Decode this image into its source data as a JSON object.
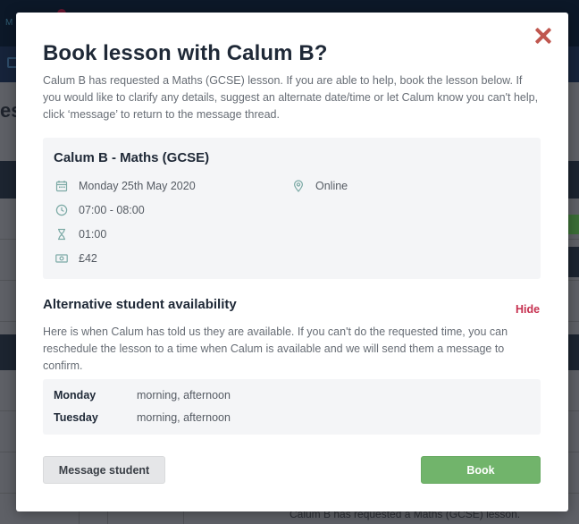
{
  "background": {
    "brand_fragment": "M",
    "title_fragment": "es",
    "footer_text": "Calum B has requested a Maths (GCSE) lesson."
  },
  "modal": {
    "title": "Book lesson with Calum B?",
    "intro": "Calum B has requested a Maths (GCSE) lesson. If you are able to help, book the lesson below. If you would like to clarify any details, suggest an alternate date/time or let Calum know you can't help, click ‘message’ to return to the message thread.",
    "close_icon": "close-icon",
    "lesson": {
      "title": "Calum B - Maths (GCSE)",
      "date": "Monday 25th May 2020",
      "location": "Online",
      "time": "07:00 - 08:00",
      "duration": "01:00",
      "price": "£42"
    },
    "alternative": {
      "title": "Alternative student availability",
      "hide_label": "Hide",
      "text": "Here is when Calum has told us they are available. If you can't do the requested time, you can reschedule the lesson to a time when Calum is available and we will send them a message to confirm.",
      "rows": [
        {
          "day": "Monday",
          "times": "morning, afternoon"
        },
        {
          "day": "Tuesday",
          "times": "morning, afternoon"
        }
      ]
    },
    "buttons": {
      "message_label": "Message student",
      "book_label": "Book"
    }
  },
  "colors": {
    "accent_red": "#c0574f",
    "hide_link": "#c6304f",
    "book_green": "#71b46b",
    "icon_teal": "#7ba9a5"
  }
}
